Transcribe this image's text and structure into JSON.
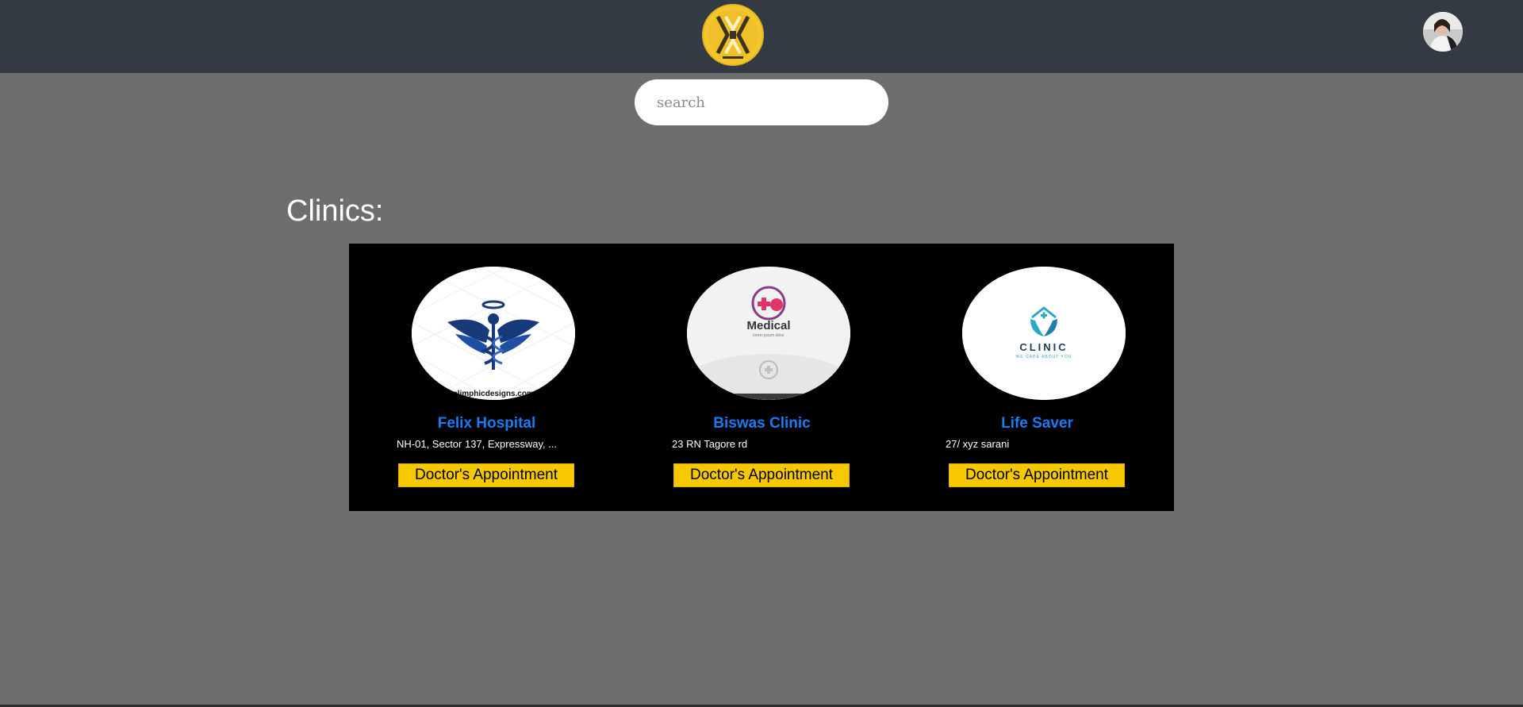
{
  "header": {
    "logo_icon": "brand-logo-icon",
    "logo_colors": {
      "ring": "#e2b81f",
      "fill": "#f1c22a",
      "bar": "#343a43"
    },
    "avatar_icon": "user-avatar"
  },
  "search": {
    "placeholder": "search",
    "value": ""
  },
  "main": {
    "title": "Clinics:"
  },
  "clinics": [
    {
      "name": "Felix Hospital",
      "address": "NH-01, Sector 137, Expressway, ...",
      "image_icon": "caduceus-logo",
      "button_label": "Doctor's Appointment"
    },
    {
      "name": "Biswas Clinic",
      "address": "23 RN Tagore rd",
      "image_icon": "medical-logo",
      "button_label": "Doctor's Appointment"
    },
    {
      "name": "Life Saver",
      "address": "27/ xyz sarani",
      "image_icon": "clinic-logo",
      "button_label": "Doctor's Appointment"
    }
  ],
  "logo_texts": {
    "felix_watermark": "slimphicdesigns.com",
    "biswas_logo": "Medical",
    "biswas_tagline": "lorem ipsum dolor",
    "lifesaver_logo": "CLINIC",
    "lifesaver_tagline": "WE CARE ABOUT YOU"
  },
  "colors": {
    "header_bg": "#343a43",
    "page_bg": "#6e6e6e",
    "panel_bg": "#000000",
    "clinic_name": "#1a7cf5",
    "button_bg": "#f5c800"
  }
}
